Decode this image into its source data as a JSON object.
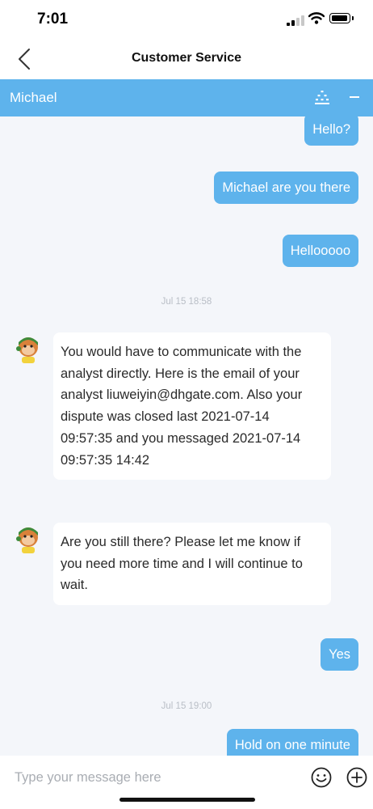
{
  "status_bar": {
    "time": "7:01"
  },
  "header": {
    "title": "Customer Service",
    "back_icon": "chevron-left-icon"
  },
  "agent_bar": {
    "name": "Michael",
    "color": "#5eb3ec"
  },
  "messages": [
    {
      "type": "outgoing",
      "text": "Hello?"
    },
    {
      "type": "outgoing",
      "text": "Michael are you there"
    },
    {
      "type": "outgoing",
      "text": "Hellooooo"
    },
    {
      "type": "timestamp",
      "text": "Jul 15 18:58"
    },
    {
      "type": "incoming",
      "lines": [
        "You would have to communicate with the",
        "analyst directly. Here is the email of your",
        "analyst liuweiyin@dhgate.com. Also your",
        "dispute was closed last 2021-07-14",
        "09:57:35 and you messaged 2021-07-14",
        "09:57:35 14:42"
      ]
    },
    {
      "type": "incoming",
      "lines": [
        "Are you still there? Please let me know if",
        "you need more time and I will continue to",
        "wait."
      ]
    },
    {
      "type": "outgoing",
      "text": "Yes"
    },
    {
      "type": "timestamp",
      "text": "Jul 15 19:00"
    },
    {
      "type": "outgoing",
      "text": "Hold on one minute"
    }
  ],
  "input": {
    "placeholder": "Type your message here",
    "value": ""
  },
  "colors": {
    "bubble_out": "#5eb3ec",
    "background": "#f4f6fa"
  }
}
